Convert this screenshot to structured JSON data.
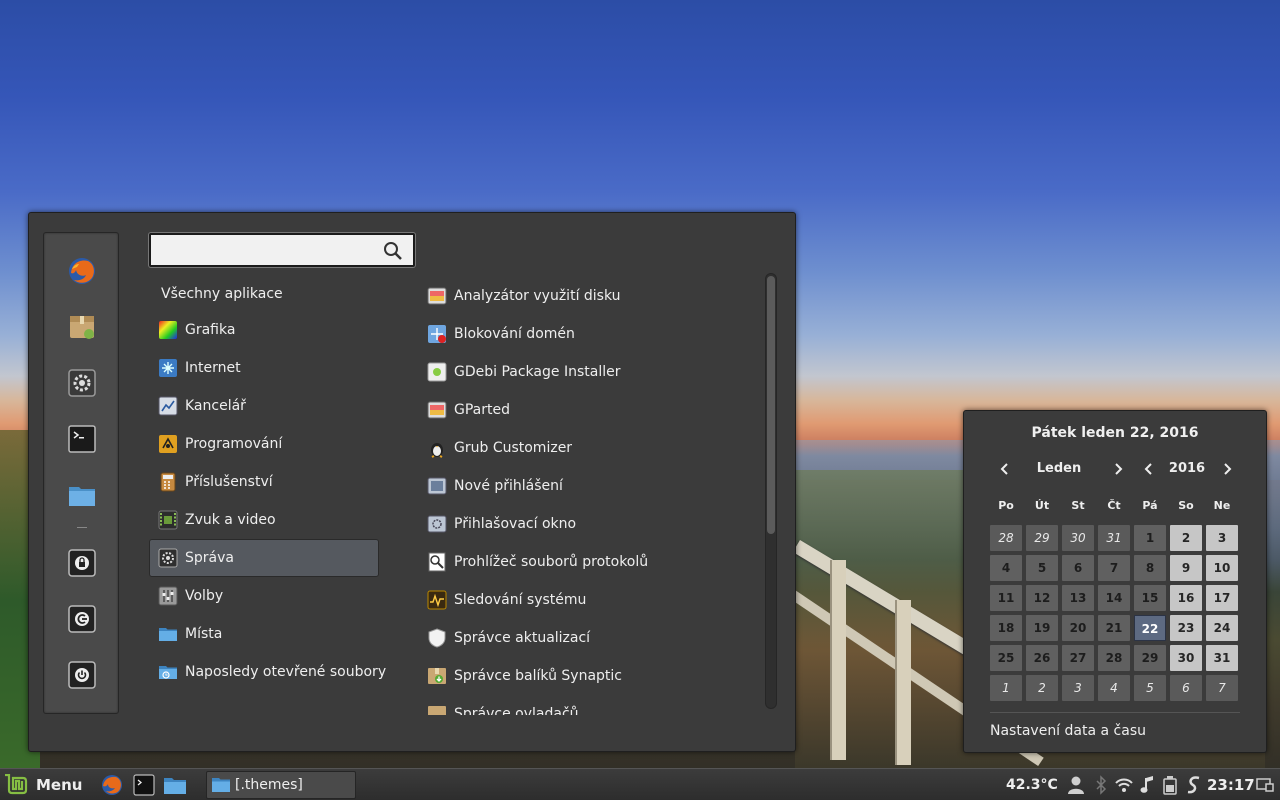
{
  "menu": {
    "search": {
      "placeholder": ""
    },
    "favorites": [
      {
        "name": "firefox-icon"
      },
      {
        "name": "package-icon"
      },
      {
        "name": "settings-icon"
      },
      {
        "name": "terminal-icon"
      },
      {
        "name": "folder-icon"
      }
    ],
    "session": [
      {
        "name": "lock-icon"
      },
      {
        "name": "logout-icon"
      },
      {
        "name": "power-icon"
      }
    ],
    "categories_all": "Všechny aplikace",
    "categories": [
      {
        "label": "Grafika",
        "icon": "graphics-icon"
      },
      {
        "label": "Internet",
        "icon": "internet-icon"
      },
      {
        "label": "Kancelář",
        "icon": "office-icon"
      },
      {
        "label": "Programování",
        "icon": "programming-icon"
      },
      {
        "label": "Příslušenství",
        "icon": "accessories-icon"
      },
      {
        "label": "Zvuk a video",
        "icon": "sound-video-icon"
      },
      {
        "label": "Správa",
        "icon": "administration-icon"
      },
      {
        "label": "Volby",
        "icon": "preferences-icon"
      },
      {
        "label": "Místa",
        "icon": "places-icon"
      },
      {
        "label": "Naposledy otevřené soubory",
        "icon": "recent-files-icon"
      }
    ],
    "apps": [
      {
        "label": "Analyzátor využití disku",
        "icon": "disk-usage-icon"
      },
      {
        "label": "Blokování domén",
        "icon": "domain-blocker-icon"
      },
      {
        "label": "GDebi Package Installer",
        "icon": "gdebi-icon"
      },
      {
        "label": "GParted",
        "icon": "gparted-icon"
      },
      {
        "label": "Grub Customizer",
        "icon": "grub-customizer-icon"
      },
      {
        "label": "Nové přihlášení",
        "icon": "new-login-icon"
      },
      {
        "label": "Přihlašovací okno",
        "icon": "login-window-icon"
      },
      {
        "label": "Prohlížeč souborů protokolů",
        "icon": "log-viewer-icon"
      },
      {
        "label": "Sledování systému",
        "icon": "system-monitor-icon"
      },
      {
        "label": "Správce aktualizací",
        "icon": "update-manager-icon"
      },
      {
        "label": "Správce balíků Synaptic",
        "icon": "synaptic-icon"
      },
      {
        "label": "Správce ovladačů",
        "icon": "driver-manager-icon"
      }
    ]
  },
  "calendar": {
    "title": "Pátek leden 22, 2016",
    "month": "Leden",
    "year": "2016",
    "weekdays": [
      "Po",
      "Út",
      "St",
      "Čt",
      "Pá",
      "So",
      "Ne"
    ],
    "weeks": [
      [
        "28",
        "29",
        "30",
        "31",
        "1",
        "2",
        "3"
      ],
      [
        "4",
        "5",
        "6",
        "7",
        "8",
        "9",
        "10"
      ],
      [
        "11",
        "12",
        "13",
        "14",
        "15",
        "16",
        "17"
      ],
      [
        "18",
        "19",
        "20",
        "21",
        "22",
        "23",
        "24"
      ],
      [
        "25",
        "26",
        "27",
        "28",
        "29",
        "30",
        "31"
      ],
      [
        "1",
        "2",
        "3",
        "4",
        "5",
        "6",
        "7"
      ]
    ],
    "today": "22",
    "settings_label": "Nastavení data a času"
  },
  "taskbar": {
    "menu_label": "Menu",
    "window_label": "[.themes]",
    "temperature": "42.3°C",
    "clock": "23:17"
  }
}
